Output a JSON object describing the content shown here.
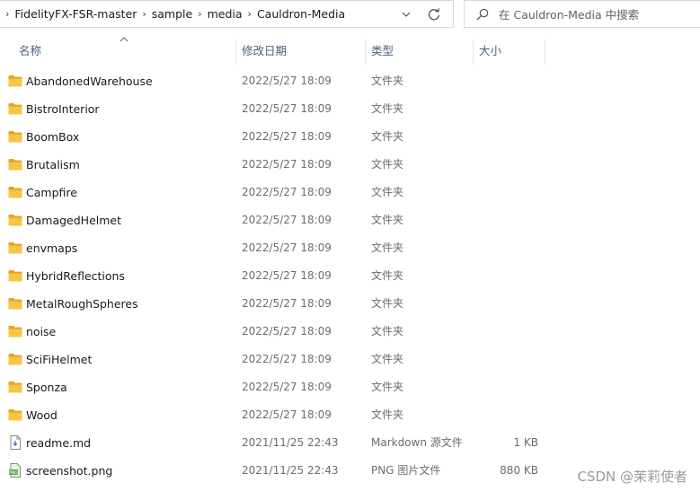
{
  "address_bar": {
    "breadcrumbs": [
      "FidelityFX-FSR-master",
      "sample",
      "media",
      "Cauldron-Media"
    ]
  },
  "search": {
    "placeholder": "在 Cauldron-Media 中搜索"
  },
  "columns": {
    "name": "名称",
    "date": "修改日期",
    "type": "类型",
    "size": "大小"
  },
  "files": [
    {
      "name": "AbandonedWarehouse",
      "date": "2022/5/27 18:09",
      "type": "文件夹",
      "size": "",
      "icon": "folder-icon"
    },
    {
      "name": "BistroInterior",
      "date": "2022/5/27 18:09",
      "type": "文件夹",
      "size": "",
      "icon": "folder-icon"
    },
    {
      "name": "BoomBox",
      "date": "2022/5/27 18:09",
      "type": "文件夹",
      "size": "",
      "icon": "folder-icon"
    },
    {
      "name": "Brutalism",
      "date": "2022/5/27 18:09",
      "type": "文件夹",
      "size": "",
      "icon": "folder-icon"
    },
    {
      "name": "Campfire",
      "date": "2022/5/27 18:09",
      "type": "文件夹",
      "size": "",
      "icon": "folder-icon"
    },
    {
      "name": "DamagedHelmet",
      "date": "2022/5/27 18:09",
      "type": "文件夹",
      "size": "",
      "icon": "folder-icon"
    },
    {
      "name": "envmaps",
      "date": "2022/5/27 18:09",
      "type": "文件夹",
      "size": "",
      "icon": "folder-icon"
    },
    {
      "name": "HybridReflections",
      "date": "2022/5/27 18:09",
      "type": "文件夹",
      "size": "",
      "icon": "folder-icon"
    },
    {
      "name": "MetalRoughSpheres",
      "date": "2022/5/27 18:09",
      "type": "文件夹",
      "size": "",
      "icon": "folder-icon"
    },
    {
      "name": "noise",
      "date": "2022/5/27 18:09",
      "type": "文件夹",
      "size": "",
      "icon": "folder-icon"
    },
    {
      "name": "SciFiHelmet",
      "date": "2022/5/27 18:09",
      "type": "文件夹",
      "size": "",
      "icon": "folder-icon"
    },
    {
      "name": "Sponza",
      "date": "2022/5/27 18:09",
      "type": "文件夹",
      "size": "",
      "icon": "folder-icon"
    },
    {
      "name": "Wood",
      "date": "2022/5/27 18:09",
      "type": "文件夹",
      "size": "",
      "icon": "folder-icon"
    },
    {
      "name": "readme.md",
      "date": "2021/11/25 22:43",
      "type": "Markdown 源文件",
      "size": "1 KB",
      "icon": "markdown-file-icon"
    },
    {
      "name": "screenshot.png",
      "date": "2021/11/25 22:43",
      "type": "PNG 图片文件",
      "size": "880 KB",
      "icon": "png-file-icon"
    }
  ],
  "watermark": "CSDN @茉莉使者",
  "colors": {
    "folder": "#f8c443",
    "folder_dark": "#e0a526",
    "header_text": "#4c607a"
  }
}
